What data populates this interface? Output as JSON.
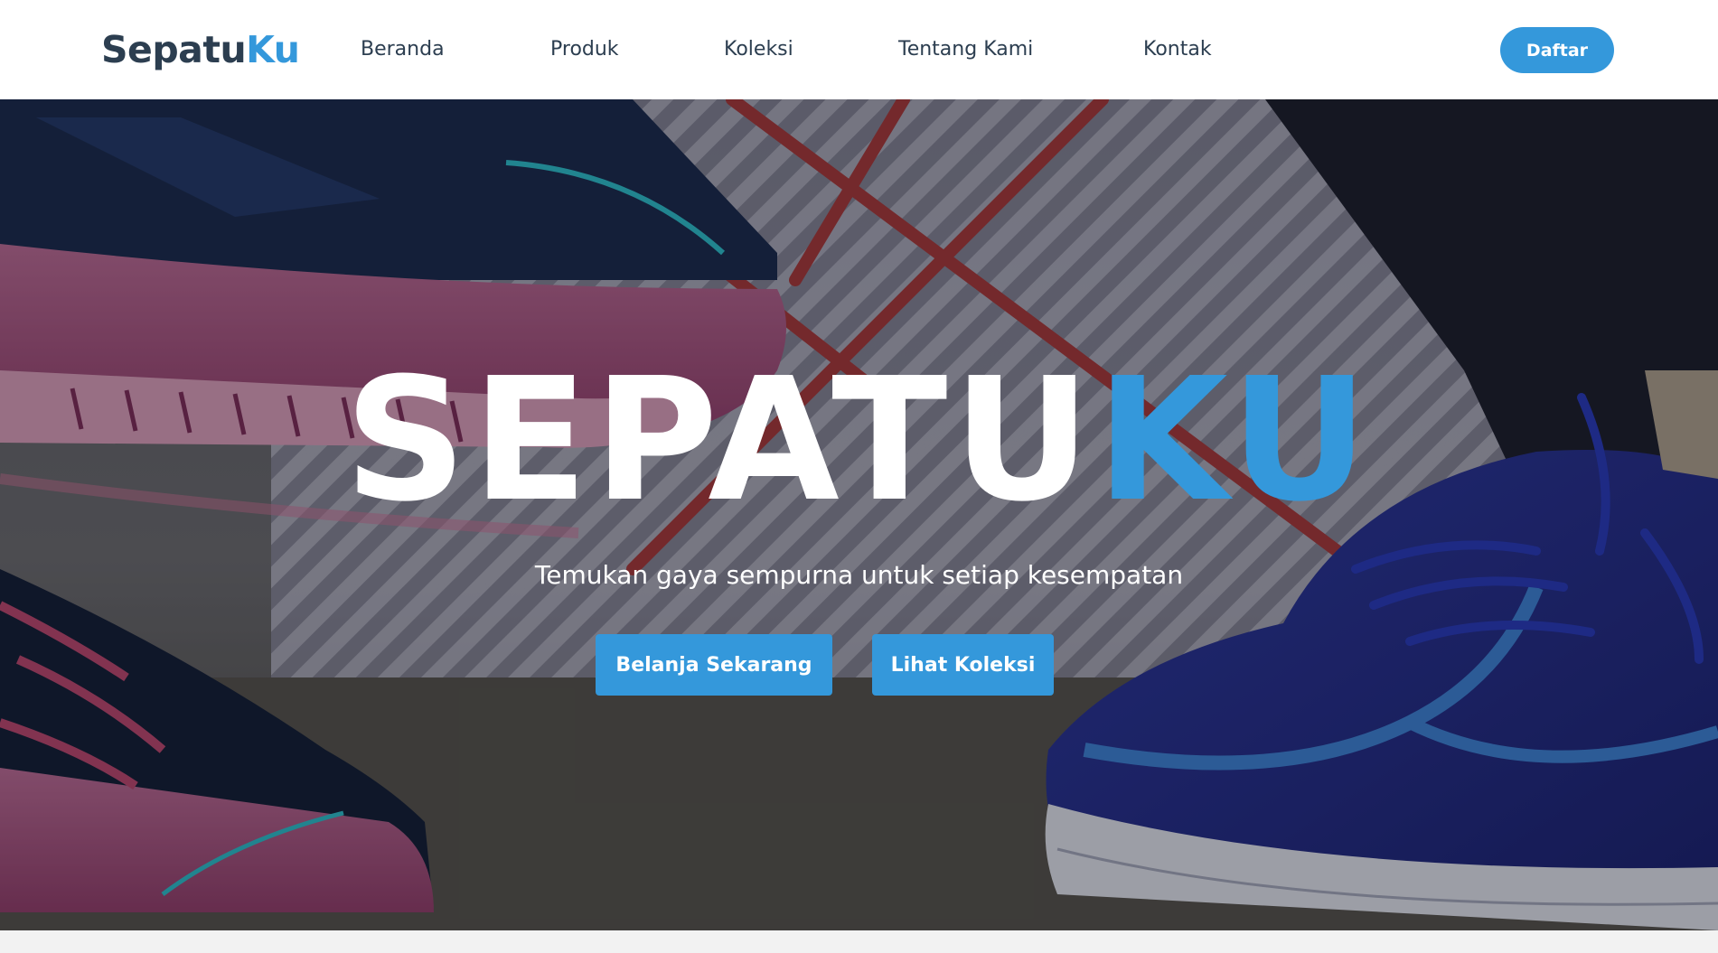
{
  "brand": {
    "part1": "Sepatu",
    "part2": "Ku"
  },
  "nav": {
    "items": [
      {
        "label": "Beranda"
      },
      {
        "label": "Produk"
      },
      {
        "label": "Koleksi"
      },
      {
        "label": "Tentang Kami"
      },
      {
        "label": "Kontak"
      }
    ],
    "signup_label": "Daftar"
  },
  "hero": {
    "title_part1": "SEPATU",
    "title_part2": "KU",
    "subtitle": "Temukan gaya sempurna untuk setiap kesempatan",
    "primary_button": "Belanja Sekarang",
    "secondary_button": "Lihat Koleksi",
    "image_description": "close-up of two sneakers, pink/teal shoe on the left and blue knit shoe on the right"
  },
  "colors": {
    "accent": "#3498db",
    "dark_text": "#2c3e50",
    "nav_background": "#ffffff",
    "page_background": "#f2f2f2"
  }
}
